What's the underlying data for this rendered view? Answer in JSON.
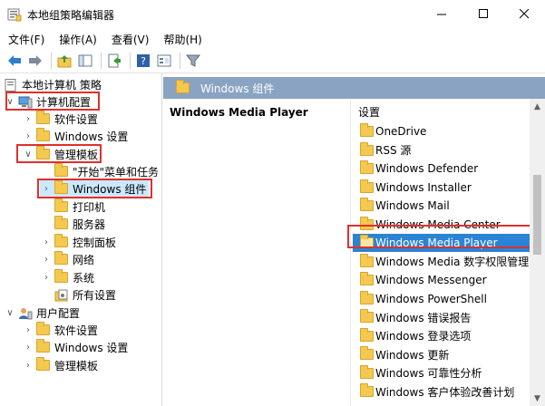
{
  "window": {
    "title": "本地组策略编辑器",
    "minimize_glyph": "—",
    "maximize_glyph": "☐",
    "close_glyph": "✕"
  },
  "menu": [
    "文件(F)",
    "操作(A)",
    "查看(V)",
    "帮助(H)"
  ],
  "toolbar": {
    "icons": [
      "back-icon",
      "forward-icon",
      "up-folder-icon",
      "show-hide-tree-icon",
      "export-icon",
      "help-icon",
      "properties-icon",
      "filter-icon"
    ]
  },
  "tree": {
    "root": "本地计算机 策略",
    "computer_config": "计算机配置",
    "software_settings": "软件设置",
    "windows_settings": "Windows 设置",
    "admin_templates": "管理模板",
    "start_menu": "\"开始\"菜单和任务",
    "windows_components": "Windows 组件",
    "printers": "打印机",
    "server": "服务器",
    "control_panel": "控制面板",
    "network": "网络",
    "system": "系统",
    "all_settings": "所有设置",
    "user_config": "用户配置",
    "user_software_settings": "软件设置",
    "user_windows_settings": "Windows 设置",
    "user_admin_templates": "管理模板"
  },
  "right": {
    "header": "Windows 组件",
    "detail_title": "Windows Media Player",
    "list_header": "设置",
    "items": [
      "OneDrive",
      "RSS 源",
      "Windows Defender",
      "Windows Installer",
      "Windows Mail",
      "Windows Media Center",
      "Windows Media Player",
      "Windows Media 数字权限管理",
      "Windows Messenger",
      "Windows PowerShell",
      "Windows 错误报告",
      "Windows 登录选项",
      "Windows 更新",
      "Windows 可靠性分析",
      "Windows 客户体验改善计划"
    ],
    "selected_item": "Windows Media Player"
  },
  "colors": {
    "highlight_box": "#e0302a",
    "selection": "#2b83d6",
    "header_bar": "#8aa3c3"
  }
}
